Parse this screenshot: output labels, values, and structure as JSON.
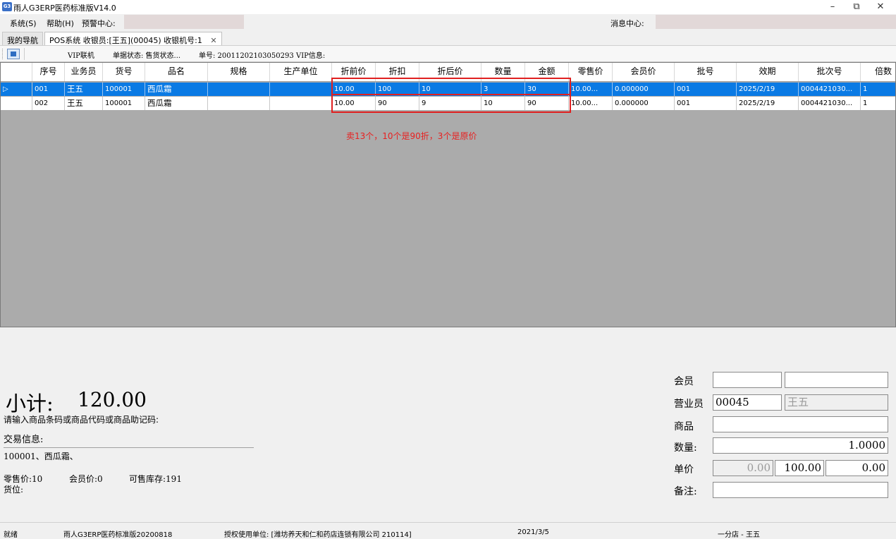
{
  "window": {
    "title": "雨人G3ERP医药标准版V14.0",
    "app_icon": "G3",
    "minimize": "–",
    "maximize": "⧉",
    "close": "✕"
  },
  "menu": {
    "system": "系统(S)",
    "help": "帮助(H)",
    "warning_center": "预警中心:",
    "message_center": "消息中心:"
  },
  "tabs": [
    {
      "label": "我的导航"
    },
    {
      "label": "POS系统 收银员:[王五](00045) 收银机号:1",
      "close": "✕"
    }
  ],
  "toolbar": {
    "vip_online": "VIP联机",
    "doc_status": "单据状态: 售货状态...",
    "doc_no": "单号: 20011202103050293",
    "vip_info": "VIP信息:"
  },
  "grid": {
    "columns": [
      "序号",
      "业务员",
      "货号",
      "品名",
      "规格",
      "生产单位",
      "折前价",
      "折扣",
      "折后价",
      "数量",
      "金额",
      "零售价",
      "会员价",
      "批号",
      "效期",
      "批次号",
      "倍数"
    ],
    "rows": [
      {
        "seq": "001",
        "clerk": "王五",
        "code": "100001",
        "name": "西瓜霜",
        "spec": "",
        "maker": "",
        "pre_price": "10.00",
        "discount": "100",
        "post_price": "10",
        "qty": "3",
        "amount": "30",
        "retail": "10.00...",
        "member": "0.000000",
        "lot": "001",
        "expiry": "2025/2/19",
        "batch": "0004421030...",
        "multiple": "1"
      },
      {
        "seq": "002",
        "clerk": "王五",
        "code": "100001",
        "name": "西瓜霜",
        "spec": "",
        "maker": "",
        "pre_price": "10.00",
        "discount": "90",
        "post_price": "9",
        "qty": "10",
        "amount": "90",
        "retail": "10.00...",
        "member": "0.000000",
        "lot": "001",
        "expiry": "2025/2/19",
        "batch": "0004421030...",
        "multiple": "1"
      }
    ],
    "selected_indicator": "▷",
    "annotation": "卖13个，10个是90折，3个是原价",
    "annotation_color": "#e82020",
    "selected_row_color": "#0a7ae4"
  },
  "summary": {
    "subtotal_label": "小计:",
    "subtotal_value": "120.00",
    "input_prompt": "请输入商品条码或商品代码或商品助记码:",
    "trade_info_label": "交易信息:",
    "trade_info": "100001、西瓜霜、",
    "retail_price": "零售价:10",
    "member_price": "会员价:0",
    "available_stock": "可售库存:191",
    "location": "货位:"
  },
  "form": {
    "member_label": "会员",
    "member_value": "",
    "member_name": "",
    "clerk_label": "营业员",
    "clerk_code": "00045",
    "clerk_name": "王五",
    "product_label": "商品",
    "product_value": "",
    "qty_label": "数量:",
    "qty_value": "1.0000",
    "price_label": "单价",
    "price_value1": "0.00",
    "price_value2": "100.00",
    "price_value3": "0.00",
    "note_label": "备注:",
    "note_value": ""
  },
  "status": {
    "ready": "就绪",
    "version": "雨人G3ERP医药标准版20200818",
    "licensee": "授权使用单位: [潍坊养天和仁和药店连锁有限公司 210114]",
    "date": "2021/3/5",
    "branch": "一分店 - 王五"
  }
}
